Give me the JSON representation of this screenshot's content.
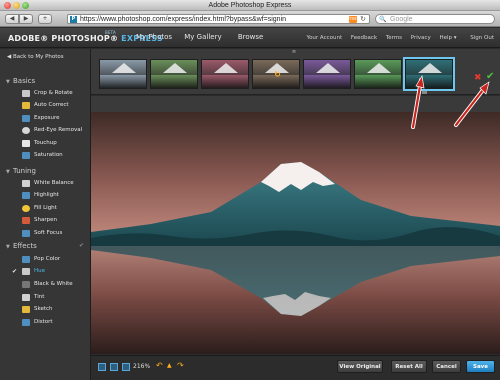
{
  "window": {
    "title": "Adobe Photoshop Express"
  },
  "browser": {
    "url": "https://www.photoshop.com/express/index.html?bypass&wf=signin",
    "search_placeholder": "Google",
    "back_glyph": "◀",
    "forward_glyph": "▶",
    "add_glyph": "+",
    "reload_glyph": "↻",
    "search_glyph": "🔍",
    "rss_glyph": "rss",
    "favicon_glyph": "P"
  },
  "header": {
    "brand_adobe": "ADOBE",
    "brand_photoshop": "PHOTOSHOP",
    "brand_express": "EXPRESS",
    "brand_beta": "BETA",
    "nav": [
      "My Photos",
      "My Gallery",
      "Browse"
    ],
    "util": [
      "Your Account",
      "Feedback",
      "Terms",
      "Privacy",
      "Help ▾",
      "Sign Out"
    ]
  },
  "sidebar": {
    "back": "◀ Back to My Photos",
    "sections": [
      {
        "title": "Basics",
        "items": [
          "Crop & Rotate",
          "Auto Correct",
          "Exposure",
          "Red-Eye Removal",
          "Touchup",
          "Saturation"
        ]
      },
      {
        "title": "Tuning",
        "items": [
          "White Balance",
          "Highlight",
          "Fill Light",
          "Sharpen",
          "Soft Focus"
        ]
      },
      {
        "title": "Effects",
        "items": [
          "Pop Color",
          "Hue",
          "Black & White",
          "Tint",
          "Sketch",
          "Distort"
        ]
      }
    ],
    "selected_item": "Hue",
    "section_arrow": "▼"
  },
  "filmstrip": {
    "thumbnail_count": 7,
    "selected_index": 6,
    "tints": [
      "#8a9aa8",
      "#6a8f5a",
      "#9b5a6a",
      "#7a6a5a",
      "#7a5a9a",
      "#5a9a5a",
      "#2f6f77"
    ],
    "cancel_glyph": "✖",
    "apply_glyph": "✔",
    "handle_glyph": "≡",
    "spinner_glyph": "↻"
  },
  "bottom": {
    "zoom": "216%",
    "undo_glyph": "↶",
    "redo_glyph": "↷",
    "up_glyph": "▲",
    "buttons": [
      "View Original",
      "Reset All",
      "Cancel",
      "Save"
    ]
  },
  "colors": {
    "accent": "#4cb7ee",
    "sky_top": "#3e2a26",
    "sky_bottom": "#c98f83",
    "mountain": "#2f6f77",
    "snow": "#f5f0ee",
    "annotation": "#c8231d"
  }
}
